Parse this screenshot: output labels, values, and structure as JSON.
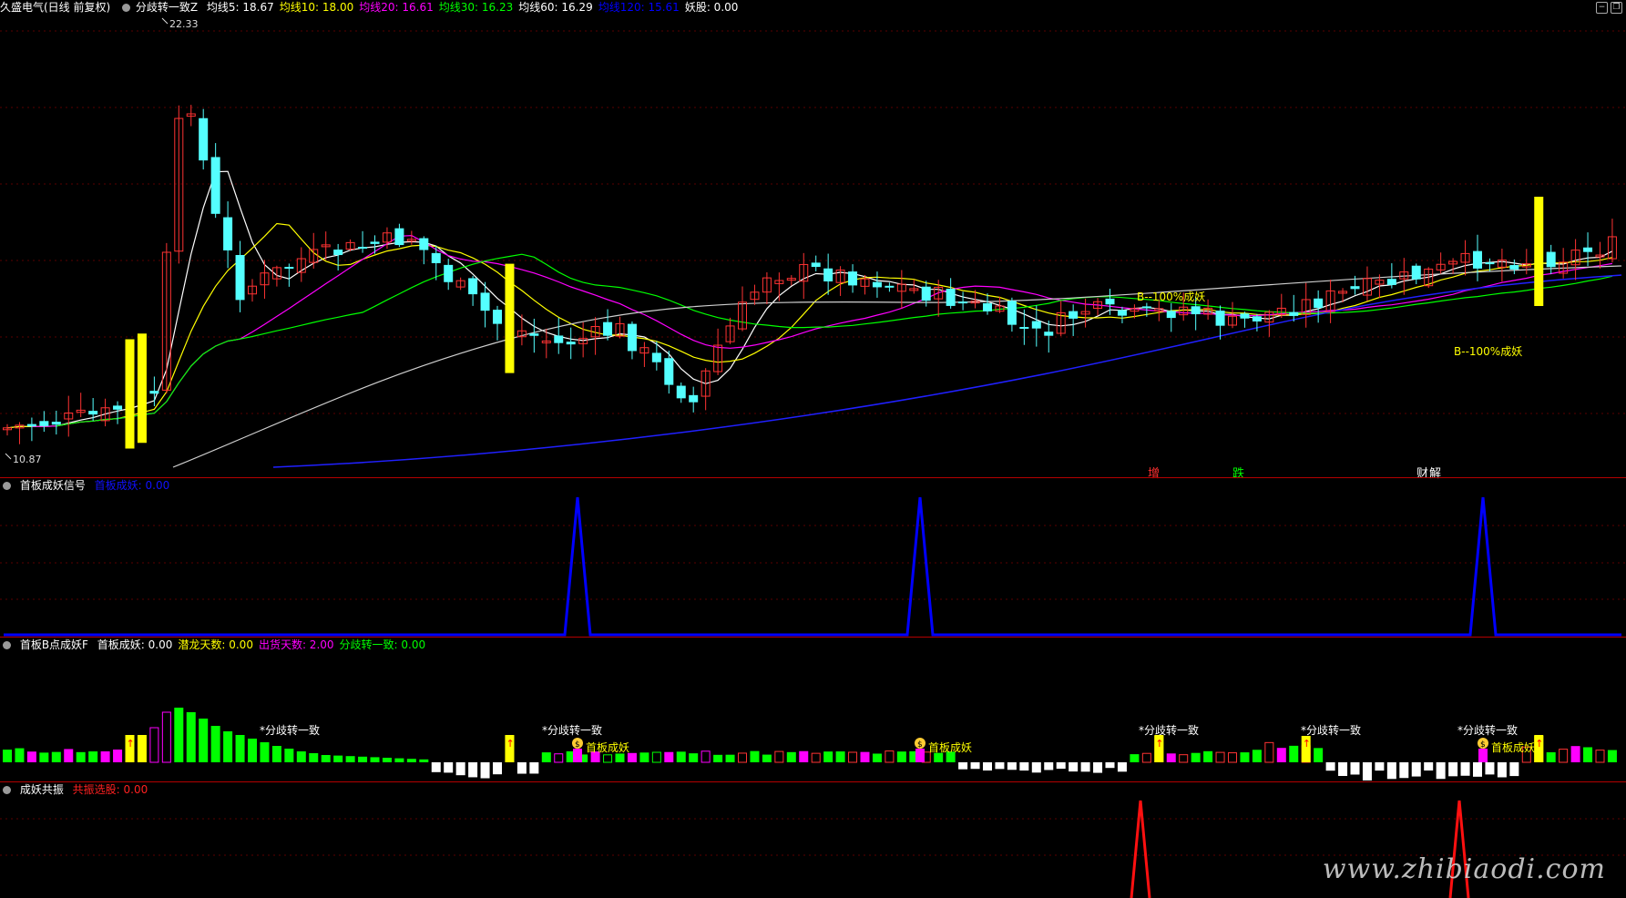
{
  "main_panel": {
    "stock": "久盛电气(日线 前复权)",
    "indicator_name": "分歧转一致Z",
    "ma_labels": [
      {
        "text": "均线5: 18.67",
        "color": "#ffffff"
      },
      {
        "text": "均线10: 18.00",
        "color": "#ffff00"
      },
      {
        "text": "均线20: 16.61",
        "color": "#ff00ff"
      },
      {
        "text": "均线30: 16.23",
        "color": "#00ff00"
      },
      {
        "text": "均线60: 16.29",
        "color": "#ffffff"
      },
      {
        "text": "均线120: 15.61",
        "color": "#0000ff"
      },
      {
        "text": "妖股: 0.00",
        "color": "#ffffff"
      }
    ],
    "high_label": "22.33",
    "low_label": "10.87",
    "signal_labels": [
      "B--100%成妖",
      "B--100%成妖"
    ],
    "events": [
      {
        "text": "增",
        "color": "#ff3030"
      },
      {
        "text": "跌",
        "color": "#00ff00"
      },
      {
        "text": "财",
        "color": "#ffffff"
      },
      {
        "text": "解",
        "color": "#ffffff"
      }
    ]
  },
  "panel2": {
    "name": "首板成妖信号",
    "value_label": "首板成妖: 0.00",
    "value_color": "#1010ff"
  },
  "panel3": {
    "name": "首板B点成妖F",
    "labels": [
      {
        "text": "首板成妖: 0.00",
        "color": "#ffffff"
      },
      {
        "text": "潜龙天数: 0.00",
        "color": "#ffff00"
      },
      {
        "text": "出货天数: 2.00",
        "color": "#ff00ff"
      },
      {
        "text": "分歧转一致: 0.00",
        "color": "#00ff00"
      }
    ],
    "marker_fenqi": "分歧转一致",
    "marker_shouban": "首板成妖"
  },
  "panel4": {
    "name": "成妖共振",
    "value_label": "共振选股: 0.00",
    "value_color": "#ff2020"
  },
  "watermark": "www.zhibiaodi.com"
}
